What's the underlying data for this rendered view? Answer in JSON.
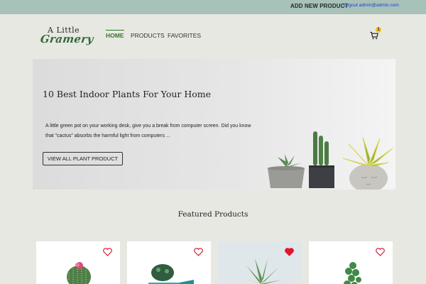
{
  "topbar": {
    "add_product": "ADD NEW PRODUCT",
    "logout": "Logout admin@admin.com"
  },
  "logo": {
    "line1": "A Little",
    "line2": "Gramery"
  },
  "nav": {
    "home": "HOME",
    "products": "PRODUCTS",
    "favorites": "FAVORITES"
  },
  "cart": {
    "count": "1",
    "icon": "cart-icon"
  },
  "hero": {
    "title": "10 Best Indoor Plants For Your Home",
    "description": "A little green pot on your working desk, give you a break from computer screen. Did you know that \"cactus\" absorbs the harmful light from computers ...",
    "button": "VIEW ALL PLANT PRODUCT"
  },
  "featured": {
    "title": "Featured Products",
    "products": [
      {
        "favorite": false
      },
      {
        "favorite": false
      },
      {
        "favorite": true
      },
      {
        "favorite": false
      }
    ]
  },
  "colors": {
    "topbar": "#a8c1b9",
    "accent": "#2a7a2a",
    "heart_active": "#e0162b",
    "badge": "#f2c12e"
  }
}
